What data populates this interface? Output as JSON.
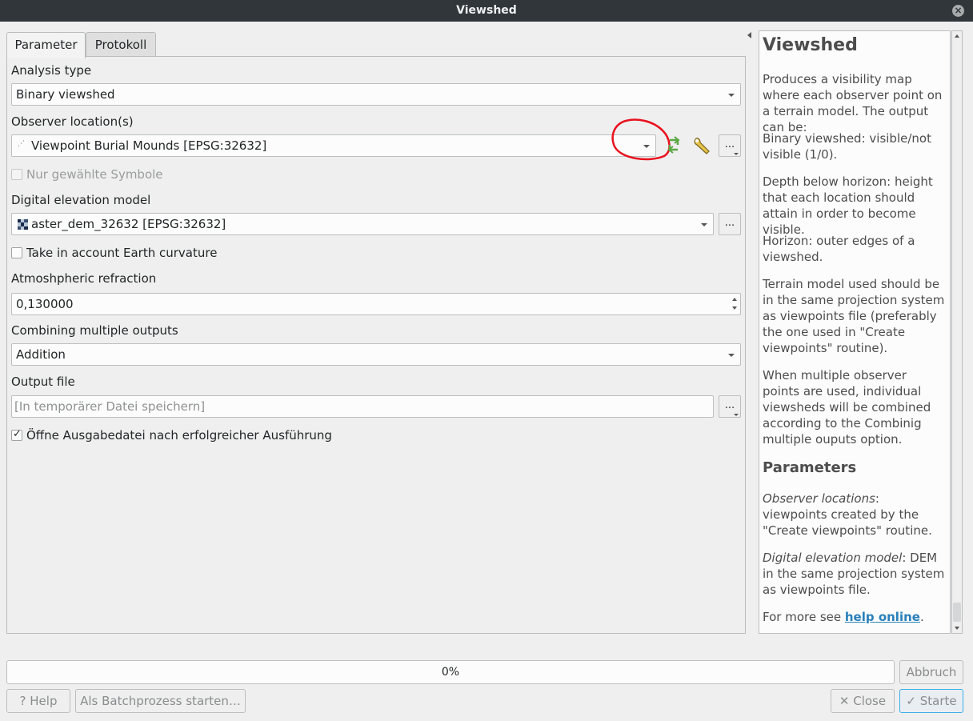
{
  "window": {
    "title": "Viewshed",
    "close_icon": "close-icon"
  },
  "tabs": [
    {
      "label": "Parameter"
    },
    {
      "label": "Protokoll"
    }
  ],
  "form": {
    "analysis_type_label": "Analysis type",
    "analysis_type_value": "Binary viewshed",
    "observer_label": "Observer location(s)",
    "observer_value": "Viewpoint Burial Mounds [EPSG:32632]",
    "selected_only_label": "Nur gewählte Symbole",
    "selected_only_checked": false,
    "dem_label": "Digital elevation model",
    "dem_value": "aster_dem_32632 [EPSG:32632]",
    "curvature_label": "Take in account Earth curvature",
    "curvature_checked": false,
    "refraction_label": "Atmoshpheric refraction",
    "refraction_value": "0,130000",
    "combining_label": "Combining multiple outputs",
    "combining_value": "Addition",
    "output_label": "Output file",
    "output_placeholder": "[In temporärer Datei speichern]",
    "open_output_label": "Öffne Ausgabedatei nach erfolgreicher Ausführung",
    "open_output_checked": true,
    "browse_label": "..."
  },
  "help": {
    "title": "Viewshed",
    "p1": "Produces a visibility map where each observer point on a terrain model. The output can be:",
    "p2": "Binary viewshed: visible/not visible (1/0).",
    "p3": "Depth below horizon: height that each location should attain in order to become visible.",
    "p4": "Horizon: outer edges of a viewshed.",
    "p5": "Terrain model used should be in the same projection system as viewpoints file (preferably the one used in \"Create viewpoints\" routine).",
    "p6": "When multiple observer points are used, individual viewsheds will be combined according to the Combinig multiple ouputs option.",
    "parameters_title": "Parameters",
    "observer_term": "Observer locations",
    "observer_desc": ": viewpoints created by the \"Create viewpoints\" routine.",
    "dem_term": "Digital elevation model",
    "dem_desc": ": DEM in the same projection system as viewpoints file.",
    "more_prefix": "For more see ",
    "more_link": "help online",
    "more_suffix": "."
  },
  "progress": {
    "text": "0%",
    "value": 0
  },
  "buttons": {
    "cancel": "Abbruch",
    "help": "Help",
    "batch": "Als Batchprozess starten…",
    "close": "Close",
    "start": "Starte"
  },
  "colors": {
    "annotation": "#e8121e",
    "link": "#2980b9",
    "titlebar": "#31363b"
  }
}
